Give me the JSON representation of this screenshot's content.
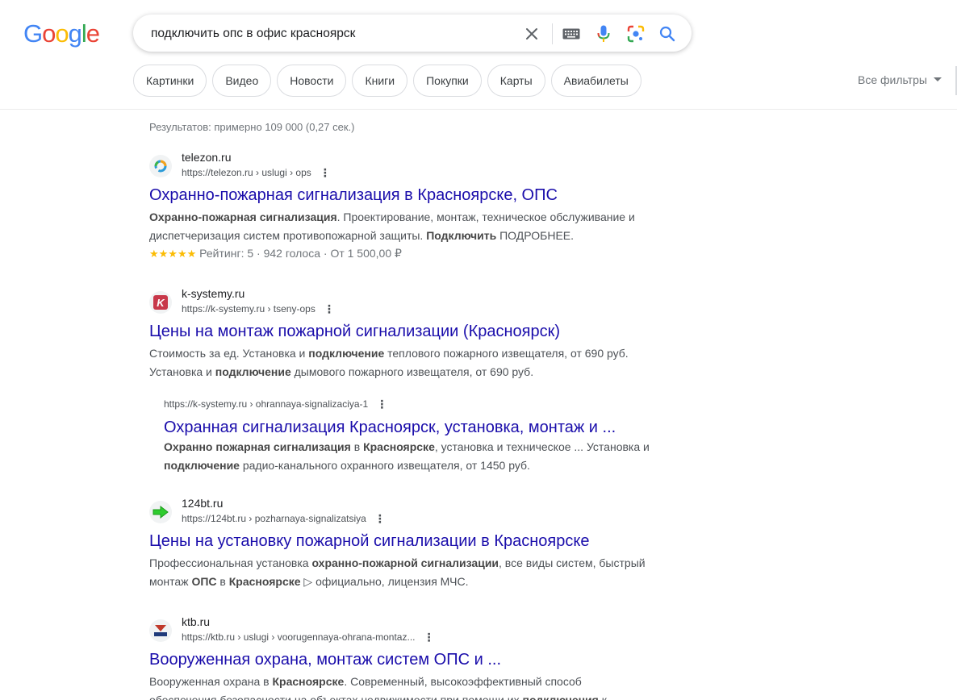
{
  "header": {
    "logo_letters": [
      {
        "ch": "G",
        "color": "#4285F4"
      },
      {
        "ch": "o",
        "color": "#EA4335"
      },
      {
        "ch": "o",
        "color": "#FBBC05"
      },
      {
        "ch": "g",
        "color": "#4285F4"
      },
      {
        "ch": "l",
        "color": "#34A853"
      },
      {
        "ch": "e",
        "color": "#EA4335"
      }
    ],
    "query": "подключить опс в офис красноярск",
    "icons": [
      "clear-icon",
      "keyboard-icon",
      "microphone-icon",
      "lens-icon",
      "search-icon"
    ]
  },
  "chips": [
    "Картинки",
    "Видео",
    "Новости",
    "Книги",
    "Покупки",
    "Карты",
    "Авиабилеты"
  ],
  "all_filters": "Все фильтры",
  "stats": "Результатов: примерно 109 000 (0,27 сек.)",
  "results": [
    {
      "site": "telezon.ru",
      "url": "https://telezon.ru › uslugi › ops",
      "title": "Охранно-пожарная сигнализация в Красноярске, ОПС",
      "snippet_html": "<b>Охранно-пожарная сигнализация</b>. Проектирование, монтаж, техническое обслуживание и диспетчеризация систем противопожарной защиты. <b>Подключить</b> ПОДРОБНЕЕ.",
      "rating_stars": "★★★★★",
      "rating_text": "Рейтинг: 5 · 942 голоса · От 1 500,00 ₽"
    },
    {
      "site": "k-systemy.ru",
      "url": "https://k-systemy.ru › tseny-ops",
      "title": "Цены на монтаж пожарной сигнализации (Красноярск)",
      "snippet_html": "Стоимость за ед. Установка и <b>подключение</b> теплового пожарного извещателя, от 690 руб. Установка и <b>подключение</b> дымового пожарного извещателя, от 690 руб."
    },
    {
      "site": "124bt.ru",
      "url": "https://124bt.ru › pozharnaya-signalizatsiya",
      "title": "Цены на установку пожарной сигнализации в Красноярске",
      "snippet_html": "Профессиональная установка <b>охранно-пожарной сигнализации</b>, все виды систем, быстрый монтаж <b>ОПС</b> в <b>Красноярске</b> ▷ официально, лицензия МЧС."
    },
    {
      "site": "ktb.ru",
      "url": "https://ktb.ru › uslugi › voorugennaya-ohrana-montaz...",
      "title": "Вооруженная охрана, монтаж систем ОПС и ...",
      "snippet_html": "Вооруженная охрана в <b>Красноярске</b>. Современный, высокоэффективный способ обеспечения безопасности на объектах недвижимости при помощи их <b>подключения</b> к ..."
    }
  ],
  "sublink": {
    "url": "https://k-systemy.ru › ohrannaya-signalizaciya-1",
    "title": "Охранная сигнализация Красноярск, установка, монтаж и ...",
    "snippet_html": "<b>Охранно пожарная сигнализация</b> в <b>Красноярске</b>, установка и техническое ... Установка и <b>подключение</b> радио-канального охранного извещателя, от 1450 руб."
  }
}
